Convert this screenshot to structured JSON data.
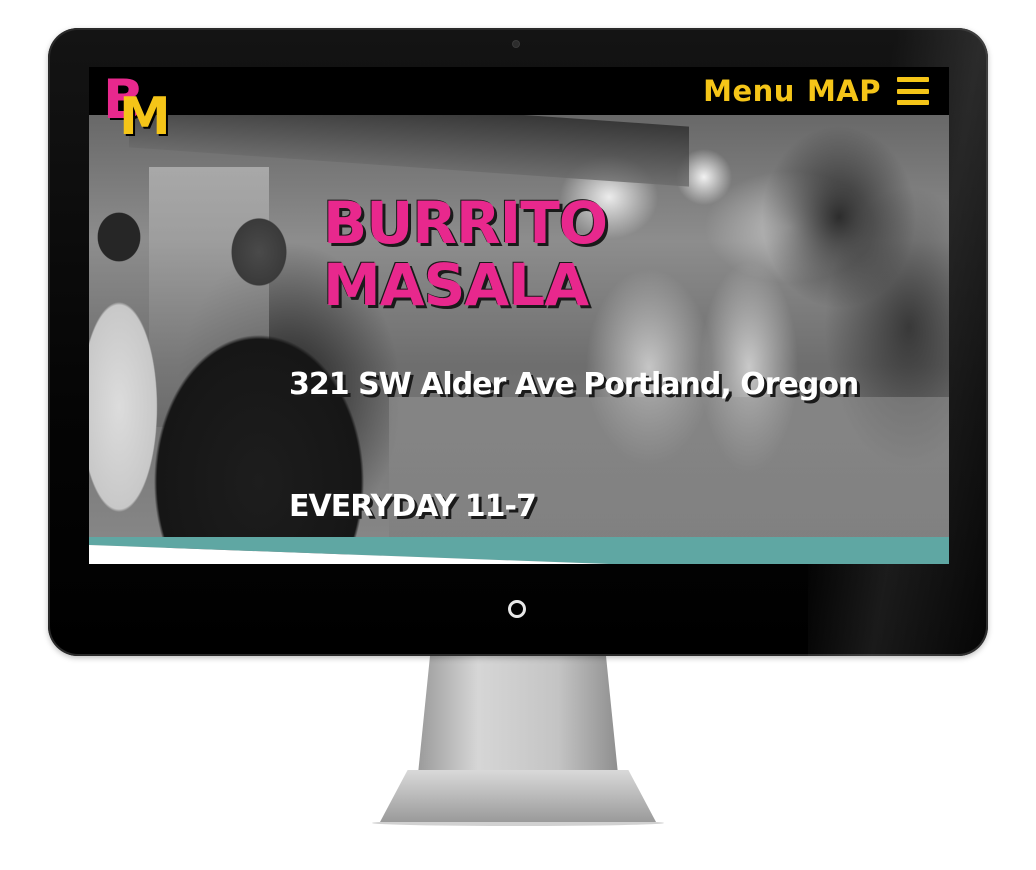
{
  "site": {
    "logo": {
      "letter_b": "B",
      "letter_m": "M"
    },
    "nav": {
      "links": [
        {
          "label": "Menu"
        },
        {
          "label": "MAP"
        }
      ],
      "hamburger_icon": "hamburger-menu-icon"
    },
    "hero": {
      "title_line1": "BURRITO",
      "title_line2": "MASALA",
      "address": "321 SW Alder Ave Portland, Oregon",
      "hours": "EVERYDAY 11-7"
    }
  },
  "colors": {
    "brand_pink": "#e8288d",
    "brand_yellow": "#f5c518",
    "teal_band": "#5fa7a3",
    "nav_background": "#000000"
  }
}
